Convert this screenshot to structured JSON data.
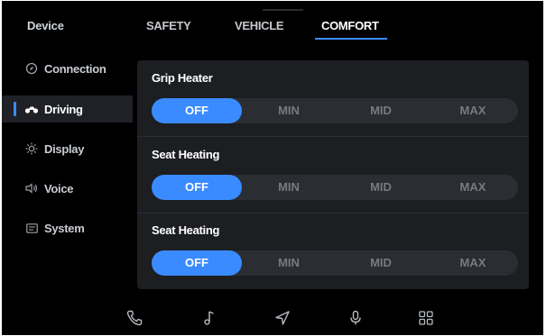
{
  "sidebar": {
    "title": "Device",
    "items": [
      {
        "label": "Connection",
        "icon": "compass-icon",
        "active": false
      },
      {
        "label": "Driving",
        "icon": "motorcycle-icon",
        "active": true
      },
      {
        "label": "Display",
        "icon": "sun-icon",
        "active": false
      },
      {
        "label": "Voice",
        "icon": "speaker-icon",
        "active": false
      },
      {
        "label": "System",
        "icon": "system-icon",
        "active": false
      }
    ]
  },
  "tabs": [
    {
      "label": "SAFETY",
      "active": false
    },
    {
      "label": "VEHICLE",
      "active": false
    },
    {
      "label": "COMFORT",
      "active": true
    }
  ],
  "sections": [
    {
      "title": "Grip Heater",
      "options": [
        "OFF",
        "MIN",
        "MID",
        "MAX"
      ],
      "selected": "OFF"
    },
    {
      "title": "Seat Heating",
      "options": [
        "OFF",
        "MIN",
        "MID",
        "MAX"
      ],
      "selected": "OFF"
    },
    {
      "title": "Seat Heating",
      "options": [
        "OFF",
        "MIN",
        "MID",
        "MAX"
      ],
      "selected": "OFF"
    }
  ],
  "bottom_bar": {
    "icons": [
      "phone-icon",
      "music-icon",
      "navigation-icon",
      "microphone-icon",
      "apps-grid-icon"
    ]
  },
  "colors": {
    "accent": "#3a8bff",
    "background": "#000000",
    "panel": "#1c1e22",
    "segment_track": "#2a2d32",
    "inactive_text": "#767a81"
  }
}
